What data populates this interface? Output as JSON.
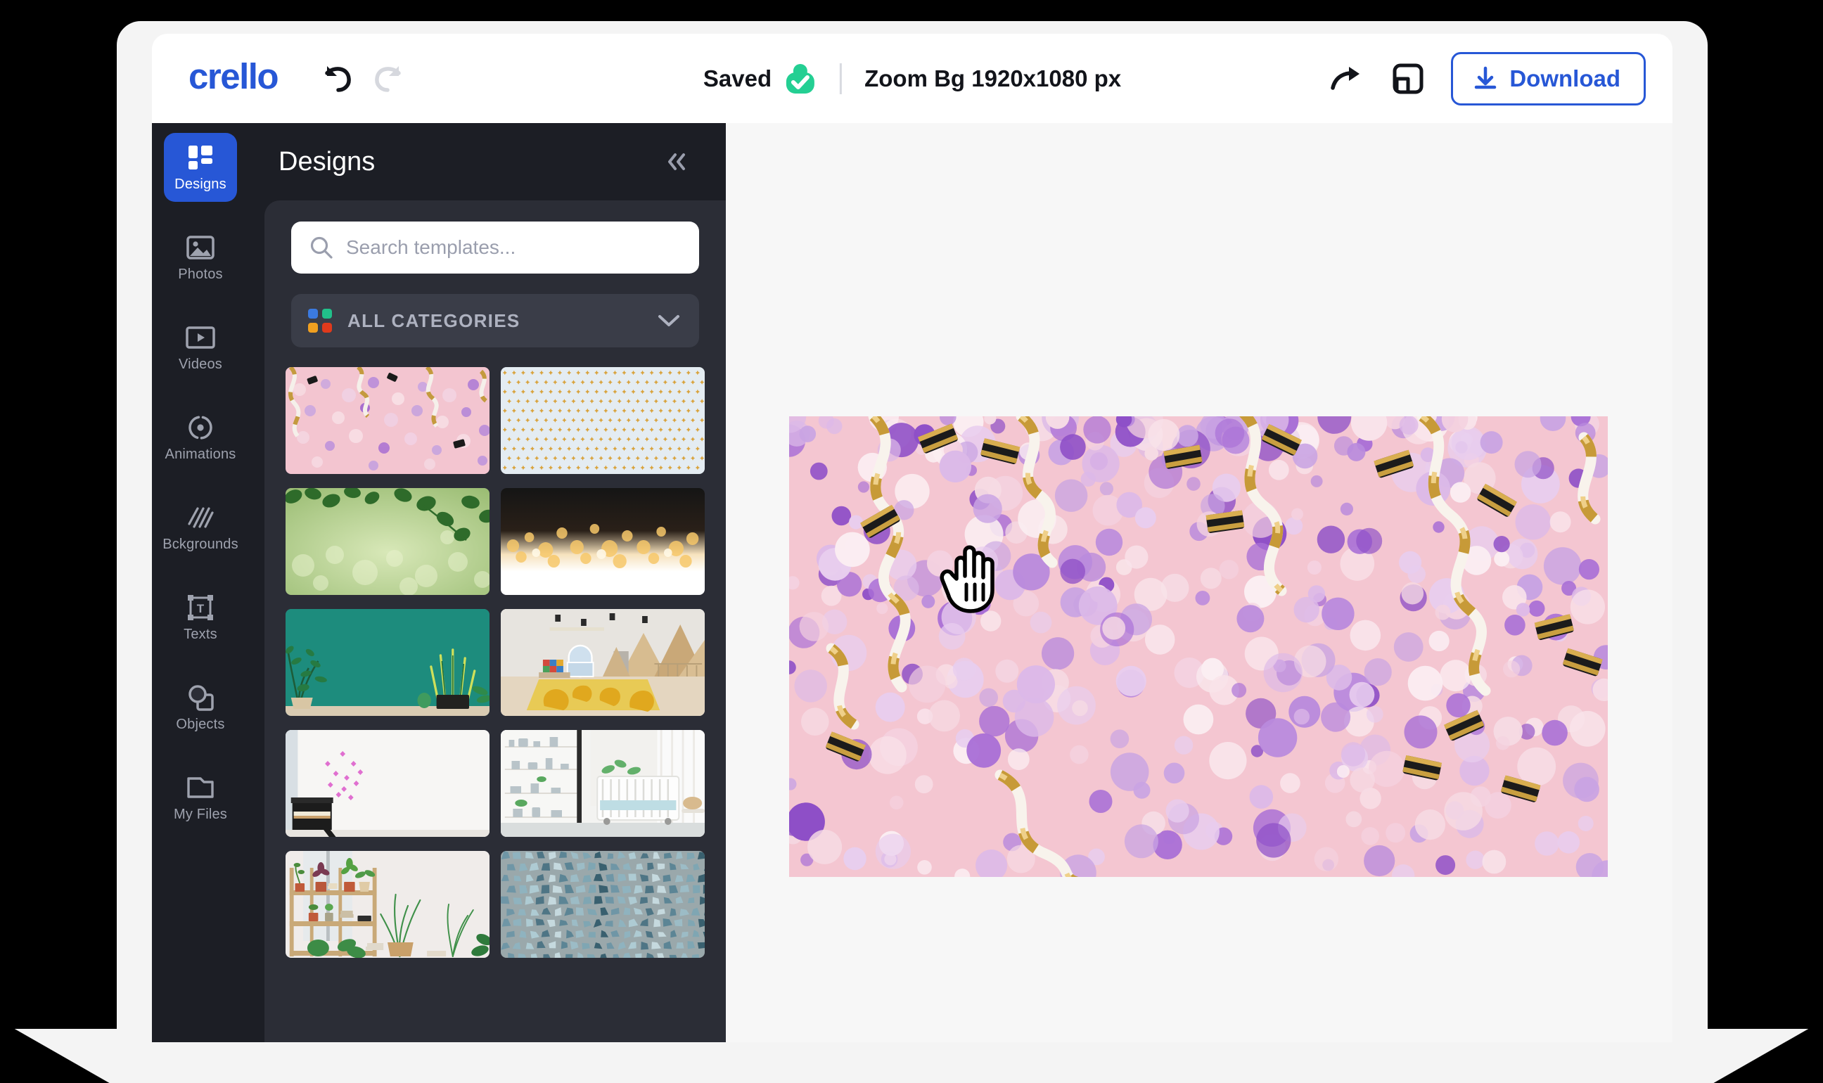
{
  "brand": {
    "logo_text": "crello",
    "accent_color": "#2757d6",
    "saved_color": "#24cf93"
  },
  "topbar": {
    "undo_icon": "undo-arrow-icon",
    "redo_icon": "redo-arrow-icon",
    "saved_label": "Saved",
    "saved_icon": "cloud-check-icon",
    "document_title": "Zoom Bg 1920x1080 px",
    "share_icon": "share-arrow-icon",
    "resize_icon": "resize-canvas-icon",
    "download_label": "Download",
    "download_icon": "download-icon"
  },
  "sidebar": {
    "items": [
      {
        "label": "Designs",
        "icon": "grid-icon",
        "active": true
      },
      {
        "label": "Photos",
        "icon": "image-icon",
        "active": false
      },
      {
        "label": "Videos",
        "icon": "video-play-icon",
        "active": false
      },
      {
        "label": "Animations",
        "icon": "orbit-dot-icon",
        "active": false
      },
      {
        "label": "Bckgrounds",
        "icon": "hatch-lines-icon",
        "active": false
      },
      {
        "label": "Texts",
        "icon": "text-box-icon",
        "active": false
      },
      {
        "label": "Objects",
        "icon": "shapes-icon",
        "active": false
      },
      {
        "label": "My Files",
        "icon": "folder-icon",
        "active": false
      }
    ]
  },
  "panel": {
    "title": "Designs",
    "collapse_icon": "chevron-double-left-icon",
    "search": {
      "icon": "search-icon",
      "value": "",
      "placeholder": "Search templates..."
    },
    "category_select": {
      "icon": "four-dots-icon",
      "label": "ALL CATEGORIES",
      "chevron": "chevron-down-icon",
      "dot_colors": [
        "#3b7ae0",
        "#21c08a",
        "#f0a020",
        "#e03a1c"
      ]
    },
    "templates": [
      {
        "name": "pink-confetti-streamers",
        "kind": "confetti-pink"
      },
      {
        "name": "gold-stars-on-pale-blue",
        "kind": "gold-stars"
      },
      {
        "name": "green-bokeh-leaves",
        "kind": "green-bokeh"
      },
      {
        "name": "gold-bokeh-lights",
        "kind": "gold-bokeh"
      },
      {
        "name": "plants-on-teal-wall",
        "kind": "teal-plants"
      },
      {
        "name": "kids-room-bean-bags",
        "kind": "kids-room"
      },
      {
        "name": "piano-butterflies-wall",
        "kind": "piano-wall"
      },
      {
        "name": "white-nursery-crib",
        "kind": "nursery"
      },
      {
        "name": "plant-shelf-window",
        "kind": "plant-shelf"
      },
      {
        "name": "blue-stone-mosaic",
        "kind": "blue-mosaic"
      }
    ]
  },
  "canvas": {
    "artwork_name": "pink-confetti-gold-streamers",
    "background_color": "#f4c6d1",
    "cursor": "pointing-hand-cursor"
  }
}
